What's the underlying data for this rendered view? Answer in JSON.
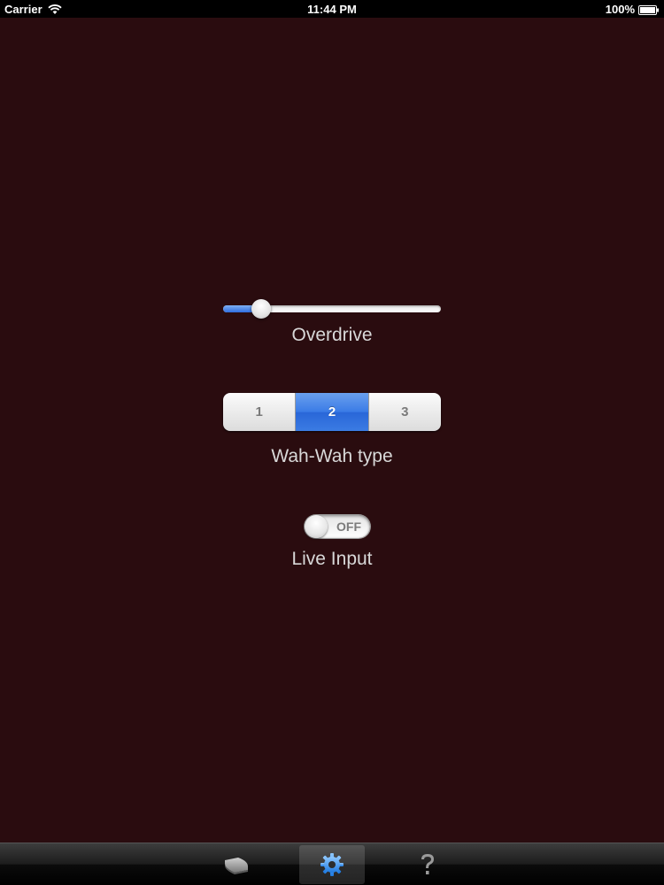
{
  "status_bar": {
    "carrier": "Carrier",
    "time": "11:44 PM",
    "battery": "100%"
  },
  "controls": {
    "overdrive": {
      "label": "Overdrive",
      "value": 0.175
    },
    "wahwah": {
      "label": "Wah-Wah type",
      "segments": [
        "1",
        "2",
        "3"
      ],
      "selected_index": 1
    },
    "live_input": {
      "label": "Live Input",
      "state_text": "OFF"
    }
  },
  "tab_bar": {
    "tabs": [
      {
        "icon": "pedal-icon",
        "selected": false
      },
      {
        "icon": "gear-icon",
        "selected": true
      },
      {
        "icon": "question-icon",
        "selected": false
      }
    ]
  },
  "colors": {
    "background": "#2a0c0f",
    "accent": "#3a7be6",
    "label_text": "#d8d8d8"
  }
}
